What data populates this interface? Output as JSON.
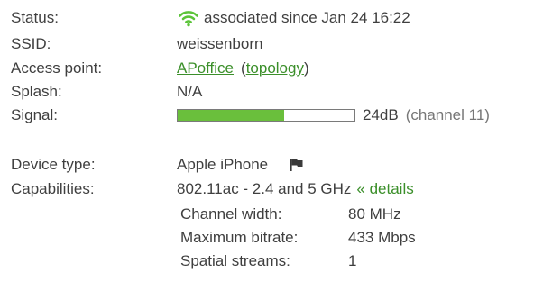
{
  "status": {
    "label": "Status:",
    "icon": "wifi-icon",
    "icon_color": "#5cc43a",
    "value": "associated since Jan 24 16:22"
  },
  "ssid": {
    "label": "SSID:",
    "value": "weissenborn"
  },
  "access_point": {
    "label": "Access point:",
    "name": "APoffice",
    "topology_open": "(",
    "topology_link": "topology",
    "topology_close": ")"
  },
  "splash": {
    "label": "Splash:",
    "value": "N/A"
  },
  "signal": {
    "label": "Signal:",
    "bar_fraction": 0.6,
    "bar_color": "#6abf3c",
    "value": "24dB",
    "channel": "(channel 11)"
  },
  "device_type": {
    "label": "Device type:",
    "value": "Apple iPhone",
    "icon": "flag-icon"
  },
  "capabilities": {
    "label": "Capabilities:",
    "value": "802.11ac - 2.4 and 5 GHz",
    "details_link": "« details",
    "details": [
      {
        "label": "Channel width:",
        "value": "80 MHz"
      },
      {
        "label": "Maximum bitrate:",
        "value": "433 Mbps"
      },
      {
        "label": "Spatial streams:",
        "value": "1"
      }
    ]
  }
}
